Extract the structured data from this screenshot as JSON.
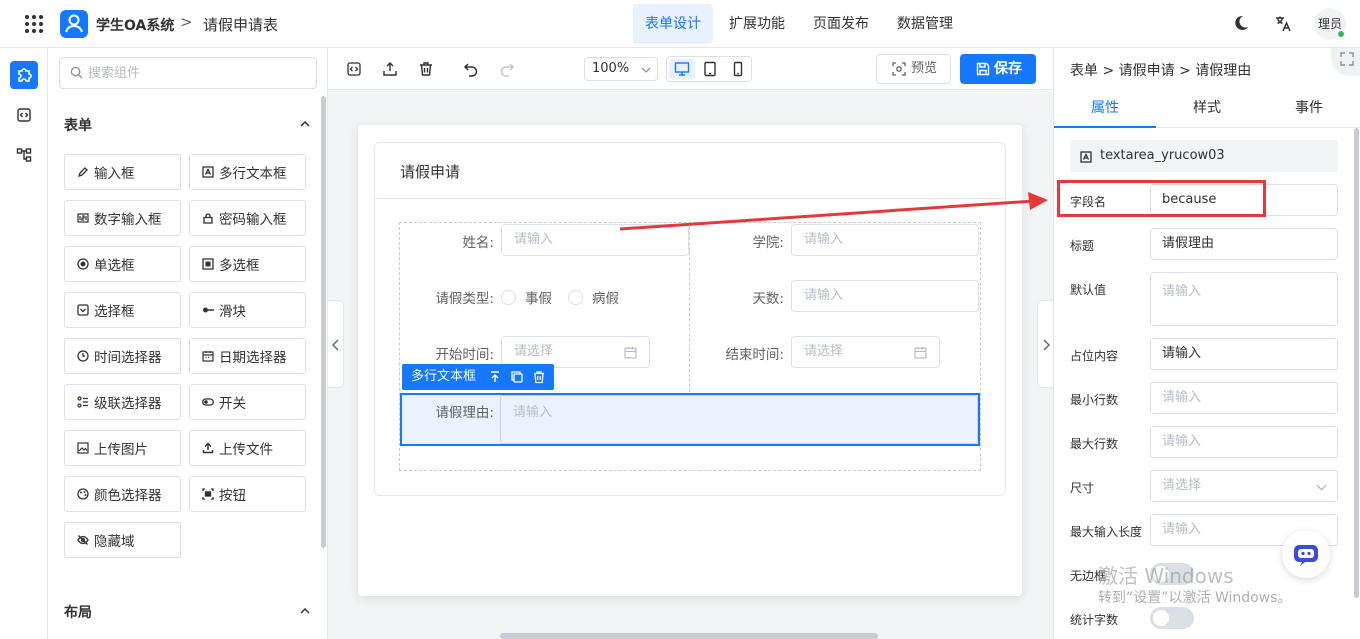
{
  "header": {
    "app_name": "学生OA系统",
    "breadcrumb_sep": ">",
    "page_title": "请假申请表",
    "nav": [
      "表单设计",
      "扩展功能",
      "页面发布",
      "数据管理"
    ],
    "avatar_text": "理员"
  },
  "components": {
    "search_placeholder": "搜索组件",
    "form_section": "表单",
    "items": [
      "输入框",
      "多行文本框",
      "数字输入框",
      "密码输入框",
      "单选框",
      "多选框",
      "选择框",
      "滑块",
      "时间选择器",
      "日期选择器",
      "级联选择器",
      "开关",
      "上传图片",
      "上传文件",
      "颜色选择器",
      "按钮",
      "隐藏域"
    ],
    "layout_section": "布局"
  },
  "toolbar": {
    "zoom": "100%",
    "preview_label": "预览",
    "save_label": "保存"
  },
  "form": {
    "title": "请假申请",
    "name_label": "姓名:",
    "name_placeholder": "请输入",
    "college_label": "学院:",
    "college_placeholder": "请输入",
    "leave_type_label": "请假类型:",
    "leave_options": [
      "事假",
      "病假"
    ],
    "days_label": "天数:",
    "days_placeholder": "请输入",
    "start_label": "开始时间:",
    "start_placeholder": "请选择",
    "end_label": "结束时间:",
    "end_placeholder": "请选择",
    "selected_component_label": "多行文本框",
    "reason_label": "请假理由:",
    "reason_placeholder": "请输入"
  },
  "props": {
    "breadcrumb": "表单 > 请假申请 > 请假理由",
    "tabs": [
      "属性",
      "样式",
      "事件"
    ],
    "component_id": "textarea_yrucow03",
    "field_name_label": "字段名",
    "field_name_value": "because",
    "title_label": "标题",
    "title_value": "请假理由",
    "default_label": "默认值",
    "default_placeholder": "请输入",
    "placeholder_label": "占位内容",
    "placeholder_value": "请输入",
    "min_rows_label": "最小行数",
    "min_rows_placeholder": "请输入",
    "max_rows_label": "最大行数",
    "max_rows_placeholder": "请输入",
    "size_label": "尺寸",
    "size_placeholder": "请选择",
    "maxlength_label": "最大输入长度",
    "maxlength_placeholder": "请输入",
    "borderless_label": "无边框",
    "word_count_label": "统计字数"
  },
  "watermark": {
    "line1": "激活 Windows",
    "line2": "转到“设置”以激活 Windows。"
  },
  "colors": {
    "primary": "#1677ff",
    "annotation": "#e23a3a"
  }
}
